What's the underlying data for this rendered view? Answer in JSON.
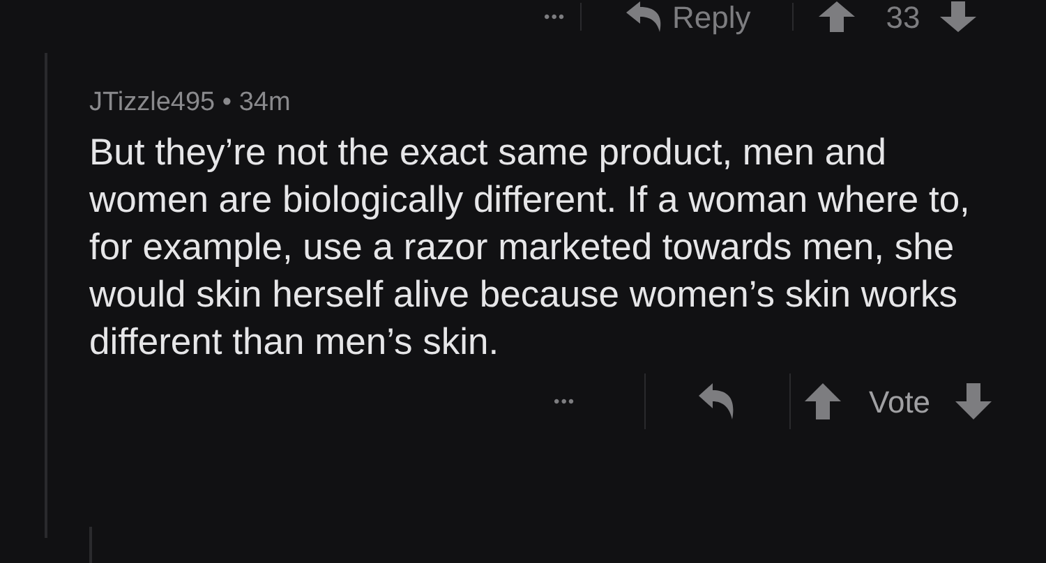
{
  "parent_actions": {
    "more": "•••",
    "reply": "Reply",
    "score": "33"
  },
  "comment": {
    "username": "JTizzle495",
    "separator": "•",
    "age": "34m",
    "body": "But they’re not the exact same product, men and women are biologically different. If a woman where to, for example, use a razor marketed towards men, she would skin herself alive because women’s skin works different than men’s skin."
  },
  "actions": {
    "more": "•••",
    "vote": "Vote"
  }
}
